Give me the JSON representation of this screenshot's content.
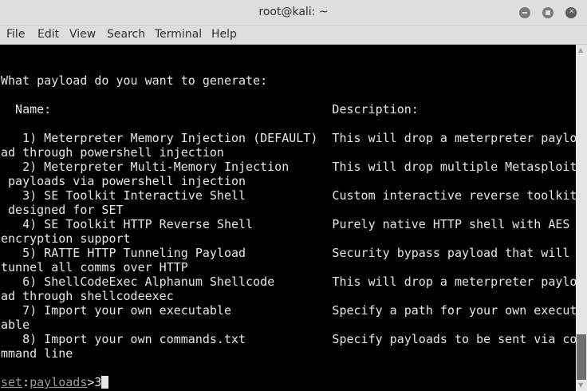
{
  "window": {
    "title": "root@kali: ~"
  },
  "menu": [
    "File",
    "Edit",
    "View",
    "Search",
    "Terminal",
    "Help"
  ],
  "terminal": {
    "lines": [
      "",
      "",
      "What payload do you want to generate:",
      "",
      "  Name:                                       Description:",
      "",
      "   1) Meterpreter Memory Injection (DEFAULT)  This will drop a meterpreter paylo",
      "ad through powershell injection",
      "   2) Meterpreter Multi-Memory Injection      This will drop multiple Metasploit",
      " payloads via powershell injection",
      "   3) SE Toolkit Interactive Shell            Custom interactive reverse toolkit",
      " designed for SET",
      "   4) SE Toolkit HTTP Reverse Shell           Purely native HTTP shell with AES",
      "encryption support",
      "   5) RATTE HTTP Tunneling Payload            Security bypass payload that will",
      "tunnel all comms over HTTP",
      "   6) ShellCodeExec Alphanum Shellcode        This will drop a meterpreter paylo",
      "ad through shellcodeexec",
      "   7) Import your own executable              Specify a path for your own execut",
      "able",
      "   8) Import your own commands.txt            Specify payloads to be sent via co",
      "mmand line",
      ""
    ],
    "prompt": {
      "module": "set",
      "sep": ":",
      "context": "payloads",
      "gt": ">",
      "input": "3"
    }
  }
}
